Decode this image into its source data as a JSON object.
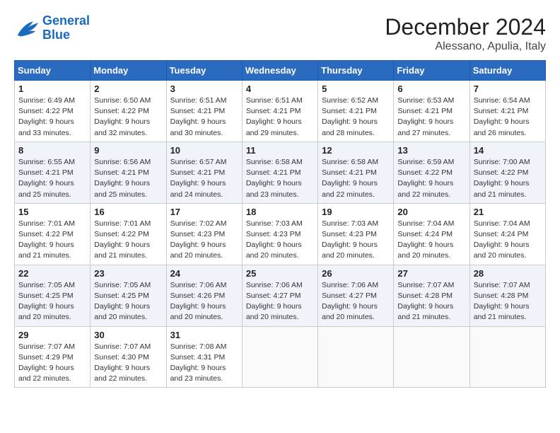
{
  "header": {
    "logo_line1": "General",
    "logo_line2": "Blue",
    "month": "December 2024",
    "location": "Alessano, Apulia, Italy"
  },
  "weekdays": [
    "Sunday",
    "Monday",
    "Tuesday",
    "Wednesday",
    "Thursday",
    "Friday",
    "Saturday"
  ],
  "weeks": [
    [
      {
        "day": "1",
        "sunrise": "6:49 AM",
        "sunset": "4:22 PM",
        "daylight": "9 hours and 33 minutes."
      },
      {
        "day": "2",
        "sunrise": "6:50 AM",
        "sunset": "4:22 PM",
        "daylight": "9 hours and 32 minutes."
      },
      {
        "day": "3",
        "sunrise": "6:51 AM",
        "sunset": "4:21 PM",
        "daylight": "9 hours and 30 minutes."
      },
      {
        "day": "4",
        "sunrise": "6:51 AM",
        "sunset": "4:21 PM",
        "daylight": "9 hours and 29 minutes."
      },
      {
        "day": "5",
        "sunrise": "6:52 AM",
        "sunset": "4:21 PM",
        "daylight": "9 hours and 28 minutes."
      },
      {
        "day": "6",
        "sunrise": "6:53 AM",
        "sunset": "4:21 PM",
        "daylight": "9 hours and 27 minutes."
      },
      {
        "day": "7",
        "sunrise": "6:54 AM",
        "sunset": "4:21 PM",
        "daylight": "9 hours and 26 minutes."
      }
    ],
    [
      {
        "day": "8",
        "sunrise": "6:55 AM",
        "sunset": "4:21 PM",
        "daylight": "9 hours and 25 minutes."
      },
      {
        "day": "9",
        "sunrise": "6:56 AM",
        "sunset": "4:21 PM",
        "daylight": "9 hours and 25 minutes."
      },
      {
        "day": "10",
        "sunrise": "6:57 AM",
        "sunset": "4:21 PM",
        "daylight": "9 hours and 24 minutes."
      },
      {
        "day": "11",
        "sunrise": "6:58 AM",
        "sunset": "4:21 PM",
        "daylight": "9 hours and 23 minutes."
      },
      {
        "day": "12",
        "sunrise": "6:58 AM",
        "sunset": "4:21 PM",
        "daylight": "9 hours and 22 minutes."
      },
      {
        "day": "13",
        "sunrise": "6:59 AM",
        "sunset": "4:22 PM",
        "daylight": "9 hours and 22 minutes."
      },
      {
        "day": "14",
        "sunrise": "7:00 AM",
        "sunset": "4:22 PM",
        "daylight": "9 hours and 21 minutes."
      }
    ],
    [
      {
        "day": "15",
        "sunrise": "7:01 AM",
        "sunset": "4:22 PM",
        "daylight": "9 hours and 21 minutes."
      },
      {
        "day": "16",
        "sunrise": "7:01 AM",
        "sunset": "4:22 PM",
        "daylight": "9 hours and 21 minutes."
      },
      {
        "day": "17",
        "sunrise": "7:02 AM",
        "sunset": "4:23 PM",
        "daylight": "9 hours and 20 minutes."
      },
      {
        "day": "18",
        "sunrise": "7:03 AM",
        "sunset": "4:23 PM",
        "daylight": "9 hours and 20 minutes."
      },
      {
        "day": "19",
        "sunrise": "7:03 AM",
        "sunset": "4:23 PM",
        "daylight": "9 hours and 20 minutes."
      },
      {
        "day": "20",
        "sunrise": "7:04 AM",
        "sunset": "4:24 PM",
        "daylight": "9 hours and 20 minutes."
      },
      {
        "day": "21",
        "sunrise": "7:04 AM",
        "sunset": "4:24 PM",
        "daylight": "9 hours and 20 minutes."
      }
    ],
    [
      {
        "day": "22",
        "sunrise": "7:05 AM",
        "sunset": "4:25 PM",
        "daylight": "9 hours and 20 minutes."
      },
      {
        "day": "23",
        "sunrise": "7:05 AM",
        "sunset": "4:25 PM",
        "daylight": "9 hours and 20 minutes."
      },
      {
        "day": "24",
        "sunrise": "7:06 AM",
        "sunset": "4:26 PM",
        "daylight": "9 hours and 20 minutes."
      },
      {
        "day": "25",
        "sunrise": "7:06 AM",
        "sunset": "4:27 PM",
        "daylight": "9 hours and 20 minutes."
      },
      {
        "day": "26",
        "sunrise": "7:06 AM",
        "sunset": "4:27 PM",
        "daylight": "9 hours and 20 minutes."
      },
      {
        "day": "27",
        "sunrise": "7:07 AM",
        "sunset": "4:28 PM",
        "daylight": "9 hours and 21 minutes."
      },
      {
        "day": "28",
        "sunrise": "7:07 AM",
        "sunset": "4:28 PM",
        "daylight": "9 hours and 21 minutes."
      }
    ],
    [
      {
        "day": "29",
        "sunrise": "7:07 AM",
        "sunset": "4:29 PM",
        "daylight": "9 hours and 22 minutes."
      },
      {
        "day": "30",
        "sunrise": "7:07 AM",
        "sunset": "4:30 PM",
        "daylight": "9 hours and 22 minutes."
      },
      {
        "day": "31",
        "sunrise": "7:08 AM",
        "sunset": "4:31 PM",
        "daylight": "9 hours and 23 minutes."
      },
      null,
      null,
      null,
      null
    ]
  ]
}
